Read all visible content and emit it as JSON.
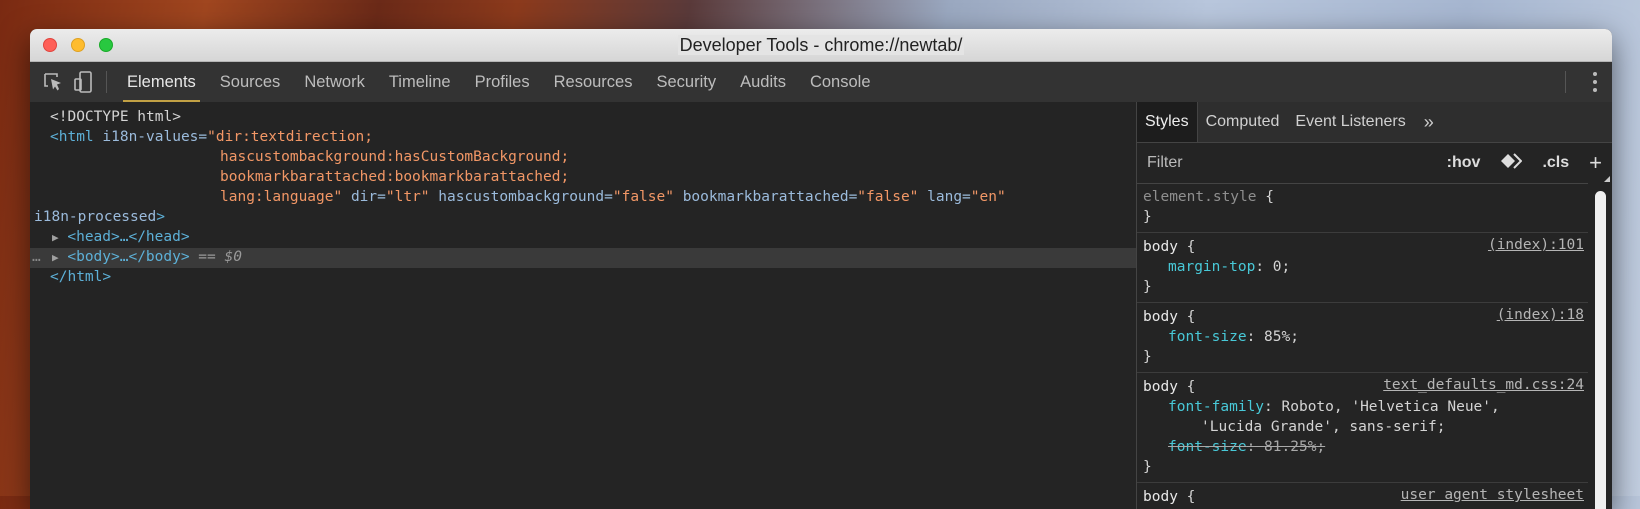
{
  "window": {
    "title": "Developer Tools - chrome://newtab/"
  },
  "toolbar": {
    "tabs": [
      {
        "label": "Elements",
        "active": true
      },
      {
        "label": "Sources"
      },
      {
        "label": "Network"
      },
      {
        "label": "Timeline"
      },
      {
        "label": "Profiles"
      },
      {
        "label": "Resources"
      },
      {
        "label": "Security"
      },
      {
        "label": "Audits"
      },
      {
        "label": "Console"
      }
    ]
  },
  "elements": {
    "doctype": "<!DOCTYPE html>",
    "html_open": "<html",
    "attr_i18n": " i18n-values=",
    "val_i18n_1": "\"dir:textdirection;",
    "val_i18n_2": "hascustombackground:hasCustomBackground;",
    "val_i18n_3": "bookmarkbarattached:bookmarkbarattached;",
    "val_i18n_4": "lang:language\"",
    "attr_dir": " dir=",
    "val_dir": "\"ltr\"",
    "attr_hcb": " hascustombackground=",
    "val_hcb": "\"false\"",
    "attr_bba": " bookmarkbarattached=",
    "val_bba": "\"false\"",
    "attr_lang": " lang=",
    "val_lang": "\"en\"",
    "attr_processed": "i18n-processed",
    "gt": ">",
    "head": "<head>…</head>",
    "body": "<body>…</body>",
    "eq": " == ",
    "dollar": "$0",
    "html_close": "</html>",
    "row_dots": "…"
  },
  "styles": {
    "tabs": [
      {
        "label": "Styles",
        "active": true
      },
      {
        "label": "Computed"
      },
      {
        "label": "Event Listeners"
      }
    ],
    "more": "»",
    "filter_placeholder": "Filter",
    "hov": ":hov",
    "cls": ".cls",
    "add": "+",
    "rules": [
      {
        "selector": "element.style",
        "source": "",
        "props": []
      },
      {
        "selector": "body",
        "source": "(index):101",
        "props": [
          {
            "name": "margin-top",
            "value": "0"
          }
        ]
      },
      {
        "selector": "body",
        "source": "(index):18",
        "props": [
          {
            "name": "font-size",
            "value": "85%"
          }
        ]
      },
      {
        "selector": "body",
        "source": "text_defaults_md.css:24",
        "props": [
          {
            "name": "font-family",
            "value": "Roboto, 'Helvetica Neue',"
          },
          {
            "name": "",
            "value": "'Lucida Grande', sans-serif"
          },
          {
            "name": "font-size",
            "value": "81.25%",
            "overridden": true
          }
        ]
      },
      {
        "selector": "body",
        "source": "user agent stylesheet",
        "props": []
      }
    ],
    "open_brace": " {",
    "close_brace": "}"
  }
}
